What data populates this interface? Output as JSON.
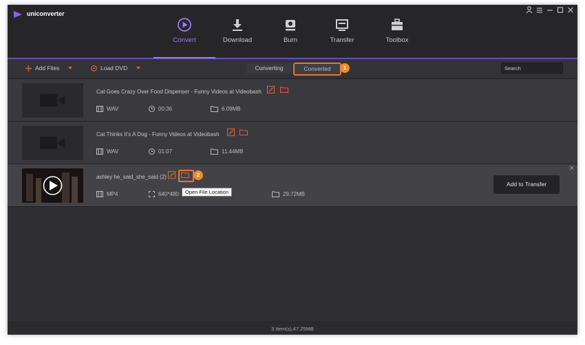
{
  "app": {
    "name": "uniconverter",
    "accent": "#9b7bf0",
    "highlight": "#e8762f"
  },
  "window_controls": [
    "user-icon",
    "menu-icon",
    "minimize-icon",
    "maximize-icon",
    "close-icon"
  ],
  "nav": [
    {
      "label": "Convert",
      "icon": "convert-icon",
      "active": true
    },
    {
      "label": "Download",
      "icon": "download-icon",
      "active": false
    },
    {
      "label": "Burn",
      "icon": "burn-icon",
      "active": false
    },
    {
      "label": "Transfer",
      "icon": "transfer-icon",
      "active": false
    },
    {
      "label": "Toolbox",
      "icon": "toolbox-icon",
      "active": false
    }
  ],
  "toolbar": {
    "add_files": "Add Files",
    "load_dvd": "Load DVD",
    "seg_converting": "Converting",
    "seg_converted": "Converted",
    "search_placeholder": "Search"
  },
  "callouts": [
    "1",
    "2"
  ],
  "files": [
    {
      "title": "Cat Goes Crazy Over Food Dispenser - Funny Videos at Videobash",
      "format": "WAV",
      "duration": "00:36",
      "size": "6.09MB"
    },
    {
      "title": "Cat Thinks It's A Dog - Funny Videos at Videobash",
      "format": "WAV",
      "duration": "01:07",
      "size": "11.44MB"
    },
    {
      "title": "ashley he_said_she_said (2)",
      "format": "MP4",
      "resolution": "640*480",
      "size": "29.72MB",
      "tooltip": "Open File Location",
      "action": "Add to Transfer"
    }
  ],
  "status": "3 Item(s),47.25MB"
}
